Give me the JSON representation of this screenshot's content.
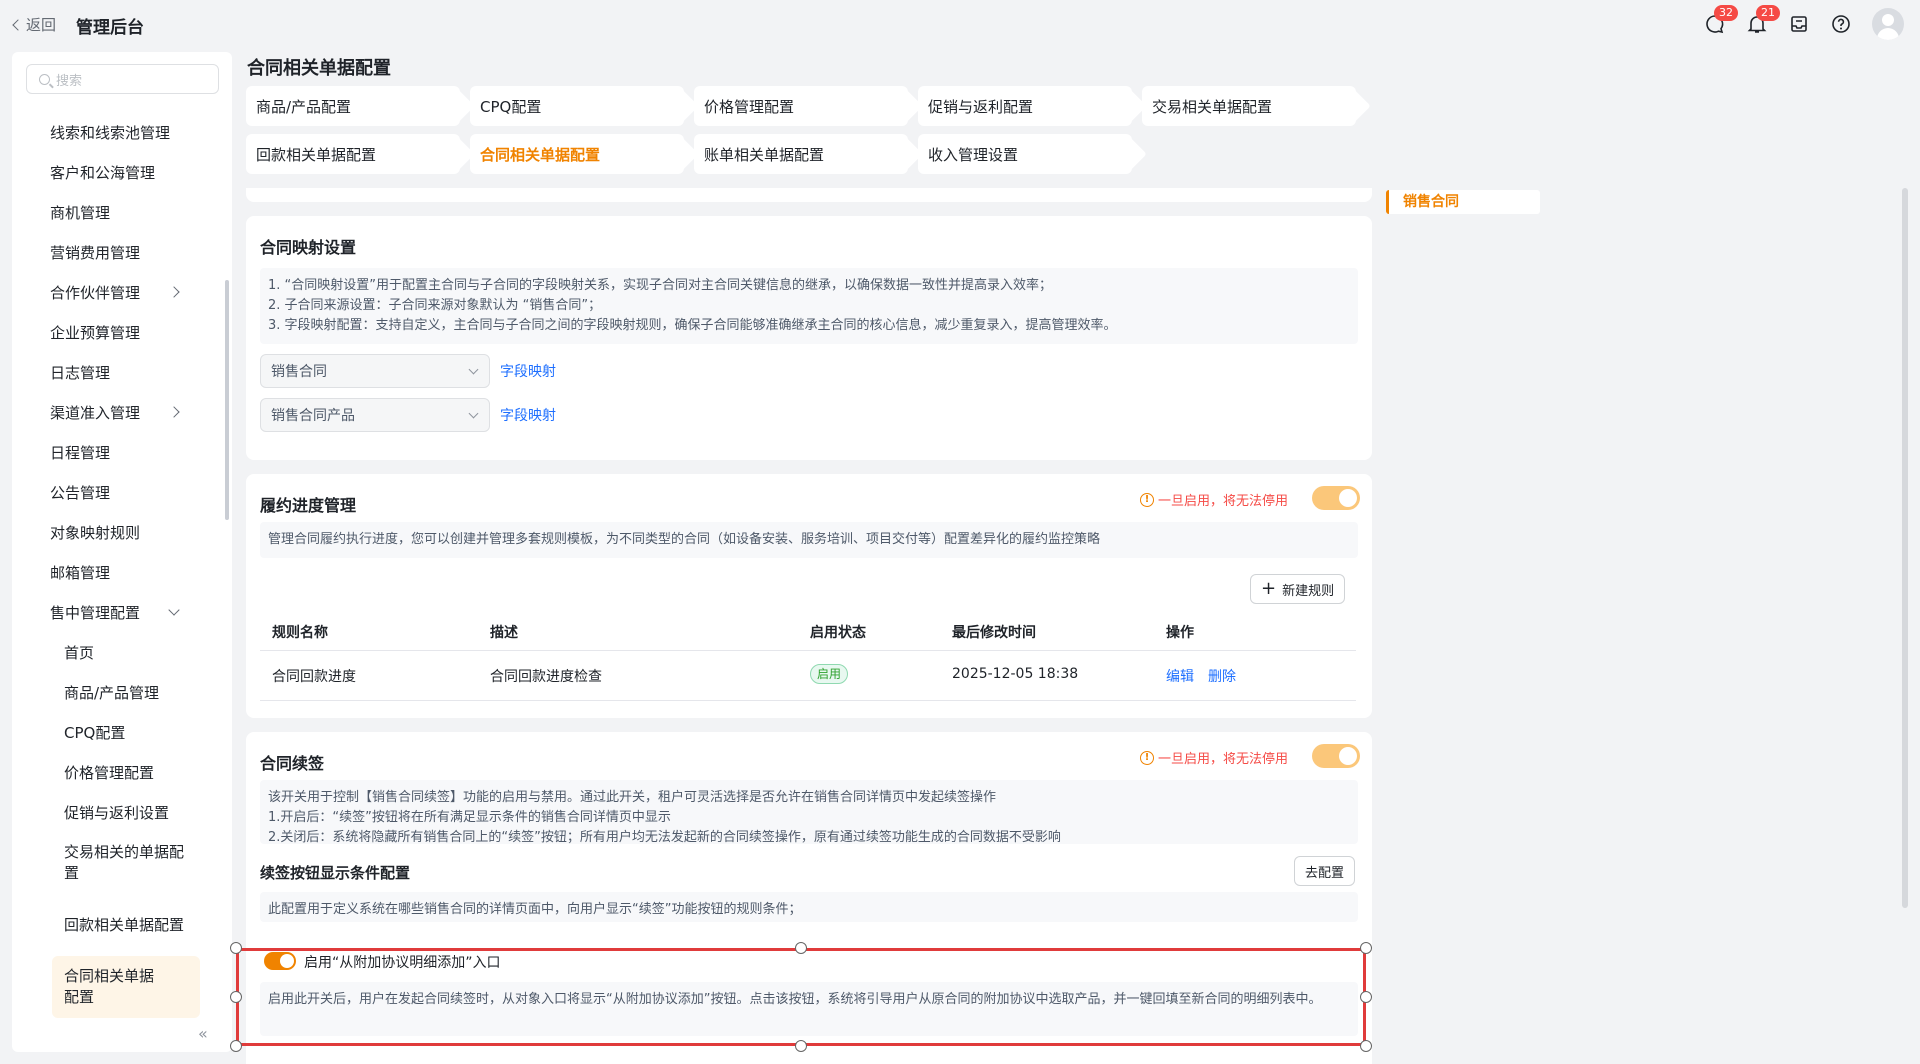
{
  "header": {
    "back_label": "返回",
    "app_title": "管理后台",
    "message_badge": "32",
    "notification_badge": "21"
  },
  "sidebar": {
    "search_placeholder": "搜索",
    "items": [
      {
        "label": "线索和线索池管理"
      },
      {
        "label": "客户和公海管理"
      },
      {
        "label": "商机管理"
      },
      {
        "label": "营销费用管理"
      },
      {
        "label": "合作伙伴管理"
      },
      {
        "label": "企业预算管理"
      },
      {
        "label": "日志管理"
      },
      {
        "label": "渠道准入管理"
      },
      {
        "label": "日程管理"
      },
      {
        "label": "公告管理"
      },
      {
        "label": "对象映射规则"
      },
      {
        "label": "邮箱管理"
      },
      {
        "label": "售中管理配置"
      }
    ],
    "sub_items": [
      {
        "label": "首页"
      },
      {
        "label": "商品/产品管理"
      },
      {
        "label": "CPQ配置"
      },
      {
        "label": "价格管理配置"
      },
      {
        "label": "促销与返利设置"
      },
      {
        "label": "交易相关的单据配置"
      },
      {
        "label": "回款相关单据配置"
      },
      {
        "label": "合同相关单据配置"
      }
    ],
    "collapse_glyph": "«"
  },
  "page": {
    "title": "合同相关单据配置",
    "tabs": [
      {
        "label": "商品/产品配置"
      },
      {
        "label": "CPQ配置"
      },
      {
        "label": "价格管理配置"
      },
      {
        "label": "促销与返利配置"
      },
      {
        "label": "交易相关单据配置"
      },
      {
        "label": "回款相关单据配置"
      },
      {
        "label": "合同相关单据配置"
      },
      {
        "label": "账单相关单据配置"
      },
      {
        "label": "收入管理设置"
      }
    ],
    "active_tab": "合同相关单据配置"
  },
  "mapping": {
    "title": "合同映射设置",
    "notes": [
      "1. “合同映射设置”用于配置主合同与子合同的字段映射关系，实现子合同对主合同关键信息的继承，以确保数据一致性并提高录入效率；",
      "2. 子合同来源设置：子合同来源对象默认为 “销售合同”；",
      "3. 字段映射配置：支持自定义，主合同与子合同之间的字段映射规则，确保子合同能够准确继承主合同的核心信息，减少重复录入，提高管理效率。"
    ],
    "select1": "销售合同",
    "select2": "销售合同产品",
    "link_label": "字段映射"
  },
  "fulfillment": {
    "title": "履约进度管理",
    "warning": "一旦启用，将无法停用",
    "description": "管理合同履约执行进度，您可以创建并管理多套规则模板，为不同类型的合同（如设备安装、服务培训、项目交付等）配置差异化的履约监控策略",
    "new_rule_label": "新建规则",
    "columns": [
      "规则名称",
      "描述",
      "启用状态",
      "最后修改时间",
      "操作"
    ],
    "rows": [
      {
        "name": "合同回款进度",
        "desc": "合同回款进度检查",
        "status": "启用",
        "modified": "2025-12-05 18:38",
        "edit": "编辑",
        "delete": "删除"
      }
    ]
  },
  "renewal": {
    "title": "合同续签",
    "warning": "一旦启用，将无法停用",
    "notes": [
      "该开关用于控制【销售合同续签】功能的启用与禁用。通过此开关，租户可灵活选择是否允许在销售合同详情页中发起续签操作",
      "1.开启后：“续签”按钮将在所有满足显示条件的销售合同详情页中显示",
      "2.关闭后：系统将隐藏所有销售合同上的“续签”按钮；所有用户均无法发起新的合同续签操作，原有通过续签功能生成的合同数据不受影响"
    ],
    "condition_title": "续签按钮显示条件配置",
    "configure_label": "去配置",
    "condition_note": "此配置用于定义系统在哪些销售合同的详情页面中，向用户显示“续签”功能按钮的规则条件；",
    "addon_toggle_label": "启用“从附加协议明细添加”入口",
    "addon_note": "启用此开关后，用户在发起合同续签时，从对象入口将显示“从附加协议添加”按钮。点击该按钮，系统将引导用户从原合同的附加协议中选取产品，并一键回填至新合同的明细列表中。"
  },
  "anchor": {
    "label": "销售合同"
  },
  "colors": {
    "accent": "#f08300",
    "danger": "#f54a45",
    "link": "#1e6fff",
    "selection": "#e03b3b"
  }
}
